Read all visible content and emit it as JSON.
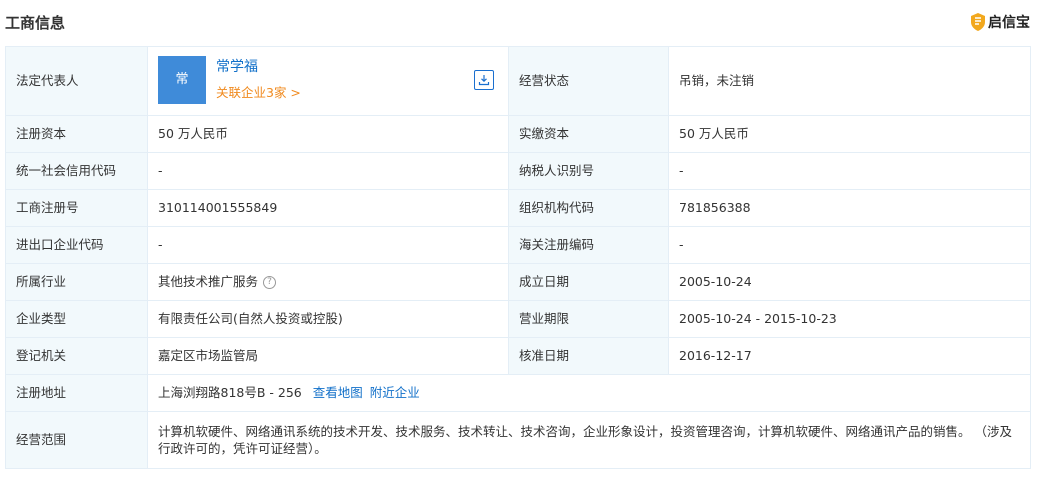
{
  "header": {
    "title": "工商信息",
    "brand": "启信宝"
  },
  "rep": {
    "label": "法定代表人",
    "avatar_char": "常",
    "name": "常学福",
    "related": "关联企业3家 >"
  },
  "rows": [
    {
      "l1": "经营状态",
      "v1": "吊销，未注销"
    },
    {
      "l1": "注册资本",
      "v1": "50 万人民币",
      "l2": "实缴资本",
      "v2": "50 万人民币"
    },
    {
      "l1": "统一社会信用代码",
      "v1": "-",
      "l2": "纳税人识别号",
      "v2": "-"
    },
    {
      "l1": "工商注册号",
      "v1": "310114001555849",
      "l2": "组织机构代码",
      "v2": "781856388"
    },
    {
      "l1": "进出口企业代码",
      "v1": "-",
      "l2": "海关注册编码",
      "v2": "-"
    },
    {
      "l1": "所属行业",
      "v1": "其他技术推广服务",
      "l2": "成立日期",
      "v2": "2005-10-24"
    },
    {
      "l1": "企业类型",
      "v1": "有限责任公司(自然人投资或控股)",
      "l2": "营业期限",
      "v2": "2005-10-24 - 2015-10-23"
    },
    {
      "l1": "登记机关",
      "v1": "嘉定区市场监管局",
      "l2": "核准日期",
      "v2": "2016-12-17"
    }
  ],
  "address": {
    "label": "注册地址",
    "value": "上海浏翔路818号B - 256",
    "map_link": "查看地图",
    "nearby_link": "附近企业"
  },
  "scope": {
    "label": "经营范围",
    "value": "计算机软硬件、网络通讯系统的技术开发、技术服务、技术转让、技术咨询，企业形象设计，投资管理咨询，计算机软硬件、网络通讯产品的销售。 （涉及行政许可的，凭许可证经营）。"
  },
  "colors": {
    "label_bg": "#f2f9fc",
    "border": "#e4eef6",
    "link": "#1270c9",
    "orange": "#f08a1e",
    "avatar": "#3f8bd9"
  }
}
